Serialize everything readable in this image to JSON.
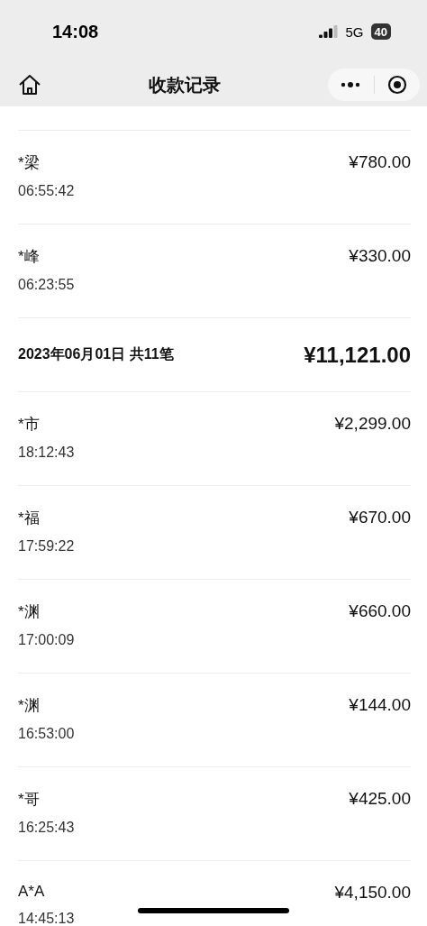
{
  "status_bar": {
    "time": "14:08",
    "network": "5G",
    "battery": "40"
  },
  "nav": {
    "title": "收款记录"
  },
  "records": [
    {
      "kind": "payment",
      "name": "*梁",
      "time": "06:55:42",
      "amount": "¥780.00"
    },
    {
      "kind": "payment",
      "name": "*峰",
      "time": "06:23:55",
      "amount": "¥330.00"
    },
    {
      "kind": "day",
      "label": "2023年06月01日 共11笔",
      "amount": "¥11,121.00"
    },
    {
      "kind": "payment",
      "name": "*市",
      "time": "18:12:43",
      "amount": "¥2,299.00"
    },
    {
      "kind": "payment",
      "name": "*福",
      "time": "17:59:22",
      "amount": "¥670.00"
    },
    {
      "kind": "payment",
      "name": "*渊",
      "time": "17:00:09",
      "amount": "¥660.00"
    },
    {
      "kind": "payment",
      "name": "*渊",
      "time": "16:53:00",
      "amount": "¥144.00"
    },
    {
      "kind": "payment",
      "name": "*哥",
      "time": "16:25:43",
      "amount": "¥425.00"
    },
    {
      "kind": "payment",
      "name": "A*A",
      "time": "14:45:13",
      "amount": "¥4,150.00"
    }
  ]
}
